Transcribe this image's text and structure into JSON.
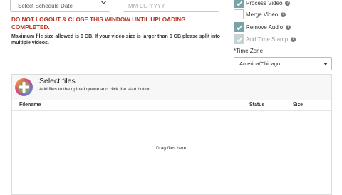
{
  "schedule": {
    "select_value": "Select Schedule Date",
    "date_placeholder": "MM-DD-YYYY"
  },
  "warning": "DO NOT LOGOUT & CLOSE THIS WINDOW UNTIL UPLOADING COMPLETED.",
  "note": "Maximum file size allowed is 6 GB. If your video size is larger than 6 GB please split into multiple videos.",
  "options": [
    {
      "label": "Process Video",
      "checked": true,
      "disabled": false,
      "help": true
    },
    {
      "label": "Merge Video",
      "checked": false,
      "disabled": false,
      "help": true
    },
    {
      "label": "Remove Audio",
      "checked": true,
      "disabled": false,
      "help": true
    },
    {
      "label": "Add Time Stamp",
      "checked": true,
      "disabled": true,
      "help": true
    }
  ],
  "help_glyph": "?",
  "timezone": {
    "label": "*Time Zone",
    "value": "America/Chicago"
  },
  "uploader": {
    "title": "Select files",
    "subtitle": "Add files to the upload queue and click the start button.",
    "columns": {
      "filename": "Filename",
      "status": "Status",
      "size": "Size"
    },
    "empty_text": "Drag files here."
  },
  "colors": {
    "warning": "#b8321f",
    "checkbox_checked": "#7aa3a8"
  }
}
